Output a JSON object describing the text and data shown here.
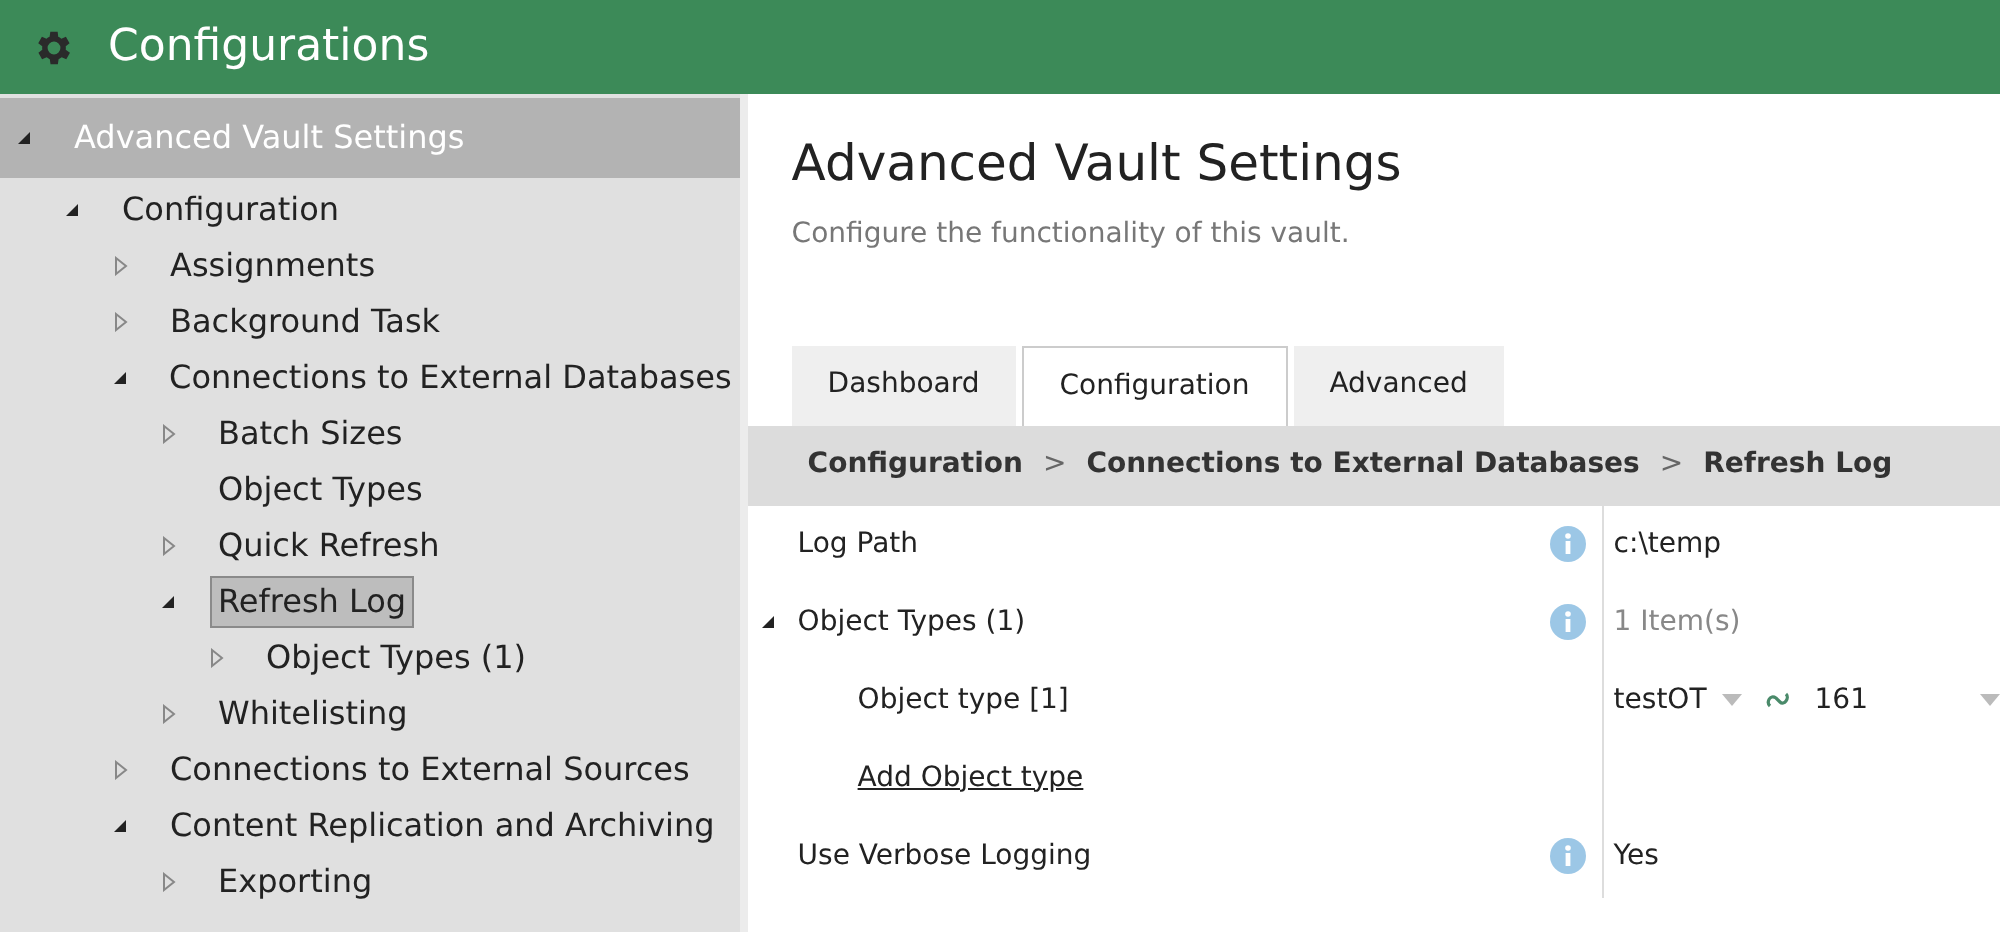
{
  "header": {
    "title": "Configurations"
  },
  "tree": [
    {
      "label": "Advanced Vault Settings",
      "kind": "node",
      "expanded": true,
      "selected": false,
      "children": [
        {
          "label": "Configuration",
          "kind": "node",
          "expanded": true,
          "selected": false,
          "children": [
            {
              "label": "Assignments",
              "kind": "node",
              "expanded": false,
              "selected": false
            },
            {
              "label": "Background Task",
              "kind": "node",
              "expanded": false,
              "selected": false
            },
            {
              "label": "Connections to External Databases",
              "kind": "node",
              "expanded": true,
              "selected": false,
              "children": [
                {
                  "label": "Batch Sizes",
                  "kind": "node",
                  "expanded": false,
                  "selected": false
                },
                {
                  "label": "Object Types",
                  "kind": "leaf",
                  "selected": false
                },
                {
                  "label": "Quick Refresh",
                  "kind": "node",
                  "expanded": false,
                  "selected": false
                },
                {
                  "label": "Refresh Log",
                  "kind": "node",
                  "expanded": true,
                  "selected": true,
                  "children": [
                    {
                      "label": "Object Types (1)",
                      "kind": "node",
                      "expanded": false,
                      "selected": false
                    }
                  ]
                },
                {
                  "label": "Whitelisting",
                  "kind": "node",
                  "expanded": false,
                  "selected": false
                }
              ]
            },
            {
              "label": "Connections to External Sources",
              "kind": "node",
              "expanded": false,
              "selected": false
            },
            {
              "label": "Content Replication and Archiving",
              "kind": "node",
              "expanded": true,
              "selected": false,
              "children": [
                {
                  "label": "Exporting",
                  "kind": "node",
                  "expanded": false,
                  "selected": false
                }
              ]
            }
          ]
        }
      ]
    }
  ],
  "page": {
    "title": "Advanced Vault Settings",
    "subtitle": "Configure the functionality of this vault."
  },
  "tabs": [
    {
      "label": "Dashboard",
      "selected": false
    },
    {
      "label": "Configuration",
      "selected": true
    },
    {
      "label": "Advanced",
      "selected": false
    }
  ],
  "breadcrumb": [
    "Configuration",
    "Connections to External Databases",
    "Refresh Log"
  ],
  "breadcrumb_separator": ">",
  "properties": [
    {
      "kind": "field",
      "label": "Log Path",
      "value": "c:\\temp"
    },
    {
      "kind": "group",
      "label": "Object Types (1)",
      "expanded": true,
      "value": "1 Item(s)"
    },
    {
      "kind": "lookup",
      "label": "Object type [1]",
      "value": "testOT",
      "id": "161"
    },
    {
      "kind": "link",
      "label": "Add Object type"
    },
    {
      "kind": "field",
      "label": "Use Verbose Logging",
      "value": "Yes"
    }
  ]
}
